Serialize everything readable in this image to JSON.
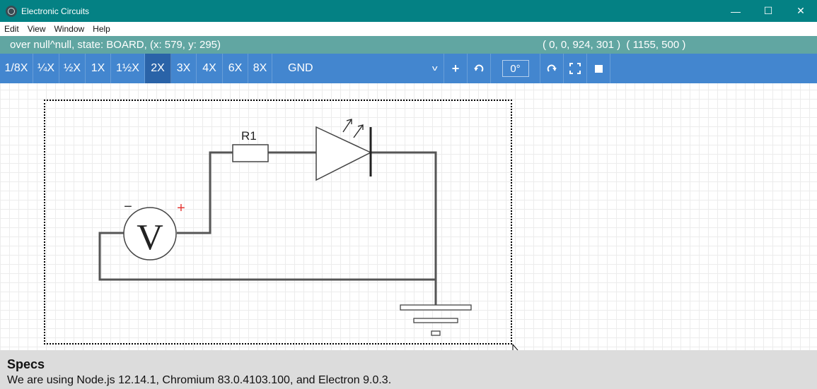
{
  "window": {
    "title": "Electronic Circuits",
    "minimize": "—",
    "maximize": "☐",
    "close": "✕"
  },
  "menu": [
    "Edit",
    "View",
    "Window",
    "Help"
  ],
  "status": {
    "left": "over null^null, state: BOARD, (x: 579, y: 295)",
    "right": "( 0, 0, 924, 301 )  ( 1155, 500 )"
  },
  "toolbar": {
    "zooms": [
      "1/8X",
      "¼X",
      "½X",
      "1X",
      "1½X",
      "2X",
      "3X",
      "4X",
      "6X",
      "8X"
    ],
    "active_zoom": "2X",
    "select_value": "GND",
    "angle": "0°",
    "icons": [
      "plus-icon",
      "rotate-left-icon",
      "rotate-right-icon",
      "fullscreen-icon",
      "stop-icon"
    ]
  },
  "circuit": {
    "resistor_label": "R1",
    "source_symbol": "V",
    "minus": "−",
    "plus": "+"
  },
  "specs": {
    "title": "Specs",
    "text": "We are using Node.js 12.14.1, Chromium 83.0.4103.100, and Electron 9.0.3."
  }
}
